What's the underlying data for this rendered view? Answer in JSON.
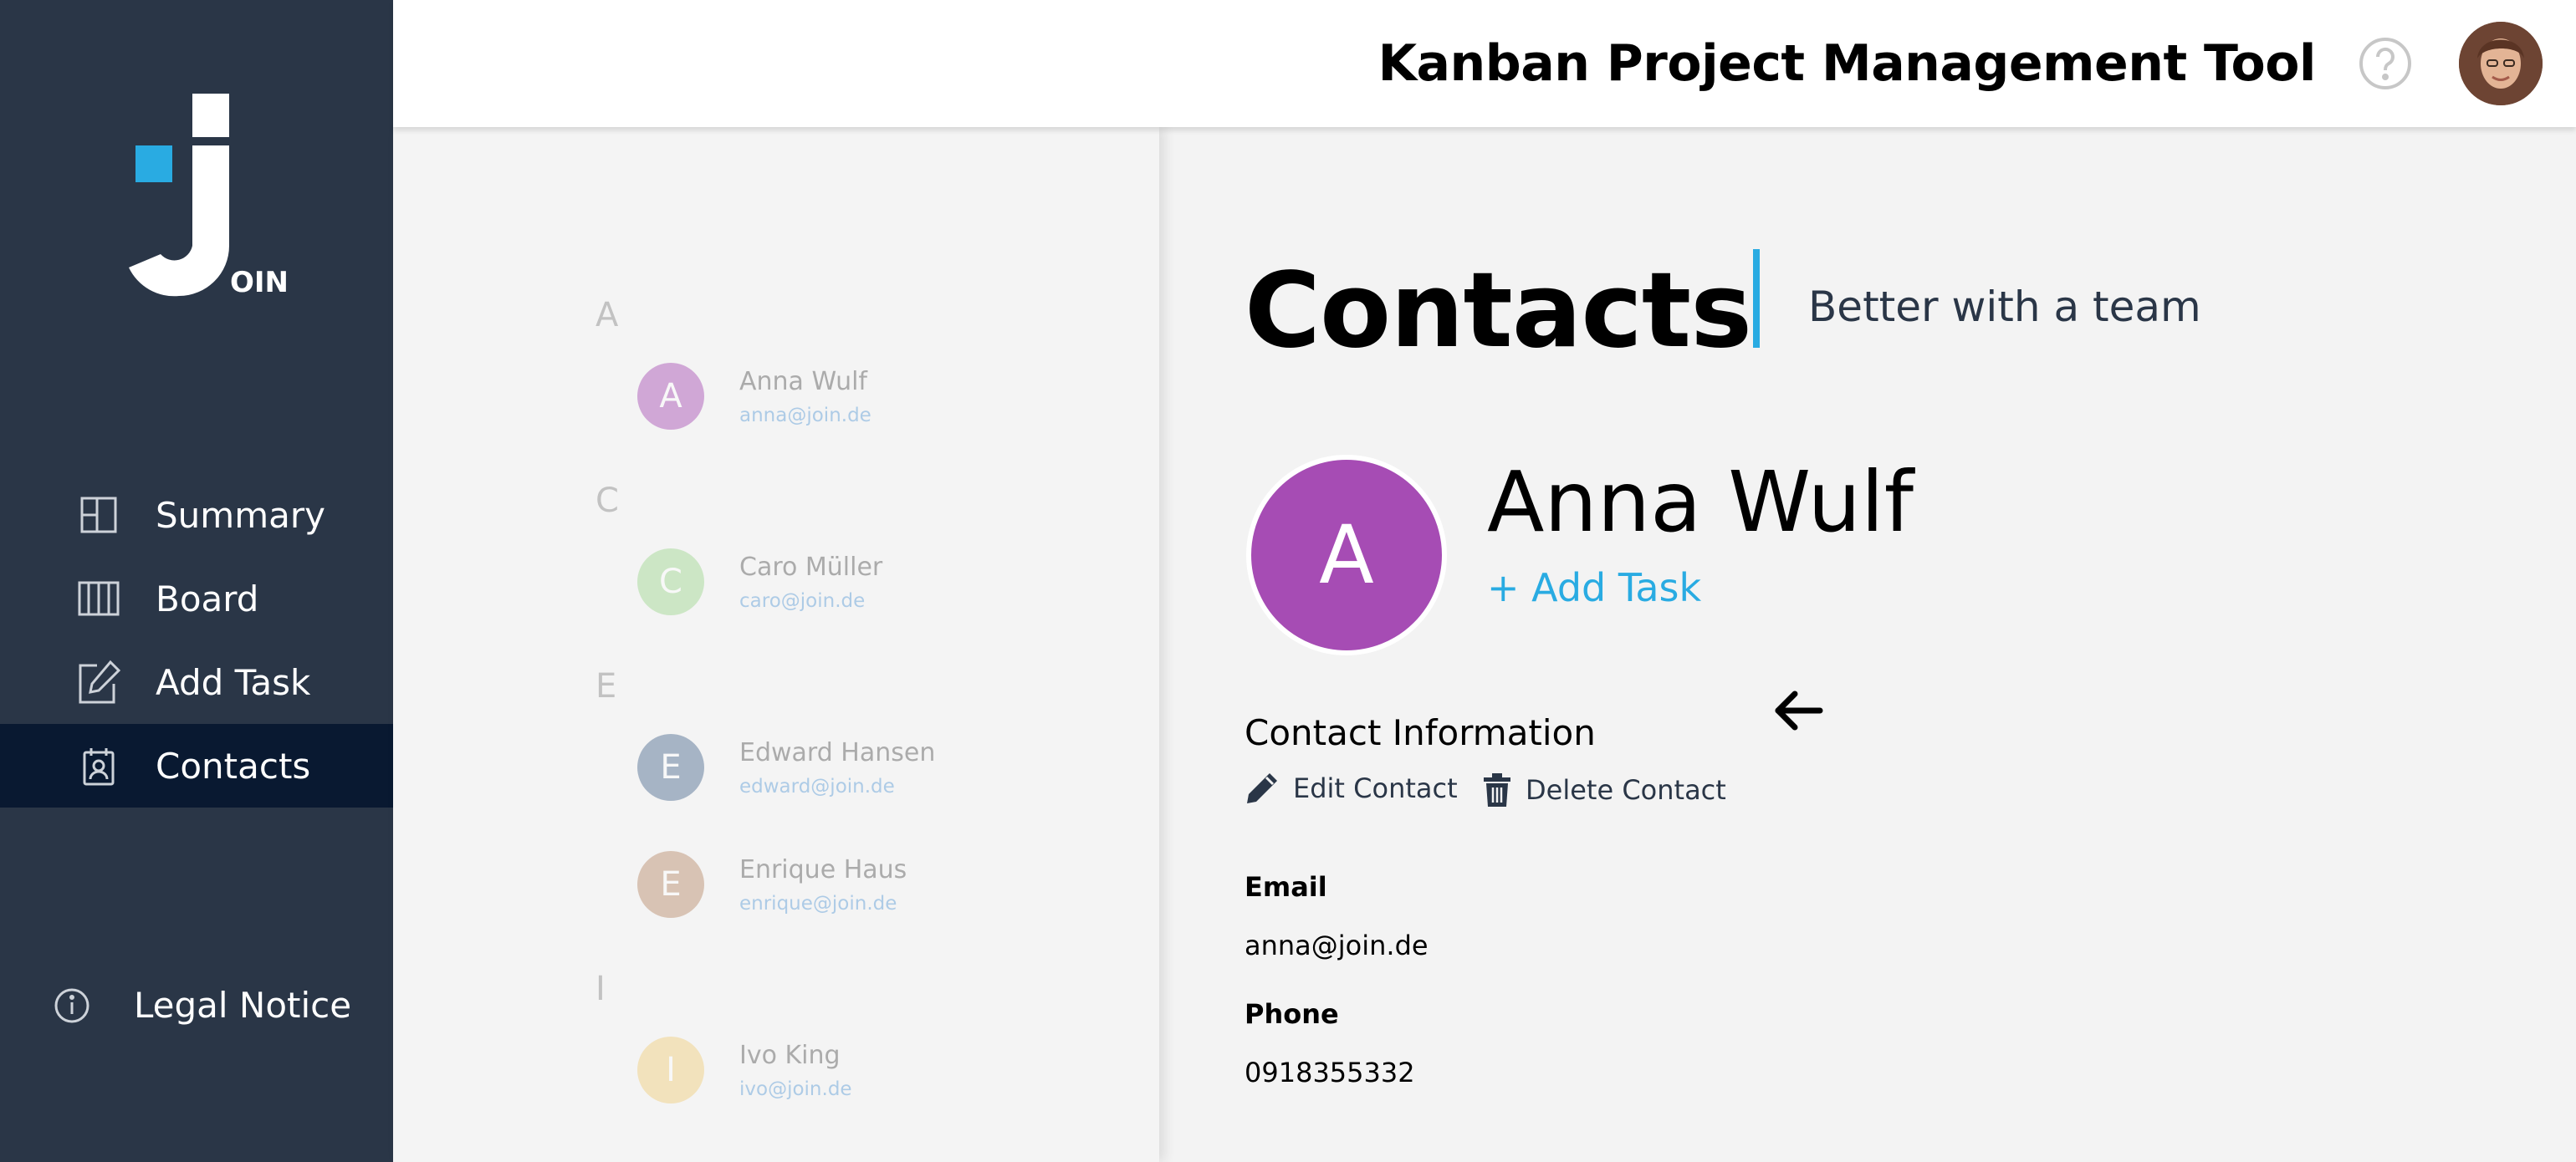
{
  "header": {
    "title": "Kanban Project Management Tool"
  },
  "logo": {
    "text": "OIN"
  },
  "sidebar": {
    "items": [
      {
        "label": "Summary"
      },
      {
        "label": "Board"
      },
      {
        "label": "Add Task"
      },
      {
        "label": "Contacts"
      }
    ],
    "legal": "Legal Notice"
  },
  "contacts": {
    "groups": [
      {
        "letter": "A",
        "contacts": [
          {
            "initial": "A",
            "name": "Anna Wulf",
            "email": "anna@join.de",
            "color": "#a64cb4"
          }
        ]
      },
      {
        "letter": "C",
        "contacts": [
          {
            "initial": "C",
            "name": "Caro Müller",
            "email": "caro@join.de",
            "color": "#9fd88f"
          }
        ]
      },
      {
        "letter": "E",
        "contacts": [
          {
            "initial": "E",
            "name": "Edward Hansen",
            "email": "edward@join.de",
            "color": "#4b6a8f"
          },
          {
            "initial": "E",
            "name": "Enrique Haus",
            "email": "enrique@join.de",
            "color": "#b88a68"
          }
        ]
      },
      {
        "letter": "I",
        "contacts": [
          {
            "initial": "I",
            "name": "Ivo King",
            "email": "ivo@join.de",
            "color": "#f2cf7a"
          }
        ]
      }
    ]
  },
  "page": {
    "title": "Contacts",
    "tagline": "Better with a team"
  },
  "selected": {
    "initial": "A",
    "name": "Anna Wulf",
    "add_task": "+ Add Task",
    "color": "#a64cb4"
  },
  "info": {
    "title": "Contact Information",
    "edit": "Edit Contact",
    "delete": "Delete Contact",
    "email_label": "Email",
    "email": "anna@join.de",
    "phone_label": "Phone",
    "phone": "0918355332"
  },
  "colors": {
    "sidebar": "#2a3647",
    "active_nav": "#091931",
    "accent": "#29abe2"
  }
}
